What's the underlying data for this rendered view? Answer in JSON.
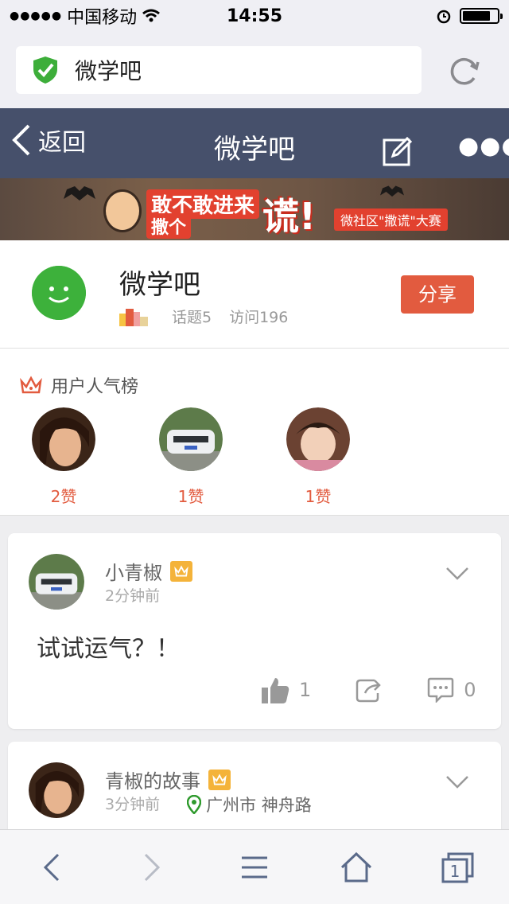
{
  "status_bar": {
    "carrier": "中国移动",
    "time": "14:55"
  },
  "url_bar": {
    "title": "微学吧",
    "icons": [
      "shield-check-icon",
      "reload-icon"
    ]
  },
  "nav": {
    "back_label": "返回",
    "title": "微学吧",
    "icons": [
      "edit-icon",
      "more-icon"
    ]
  },
  "banner": {
    "text_line1": "敢不敢进来",
    "text_line2": "撒个",
    "big_char": "谎!",
    "sub_text": "微社区\"撒谎\"大赛"
  },
  "profile": {
    "name": "微学吧",
    "topics": "话题5",
    "visits": "访问196",
    "share_label": "分享",
    "accent_color": "#e25b3f"
  },
  "ranking": {
    "title": "用户人气榜",
    "users": [
      {
        "likes": "2赞"
      },
      {
        "likes": "1赞"
      },
      {
        "likes": "1赞"
      }
    ]
  },
  "posts": [
    {
      "author": "小青椒",
      "time": "2分钟前",
      "content": "试试运气？！",
      "likes": "1",
      "comments": "0"
    },
    {
      "author": "青椒的故事",
      "time": "3分钟前",
      "location": "广州市 神舟路"
    }
  ]
}
